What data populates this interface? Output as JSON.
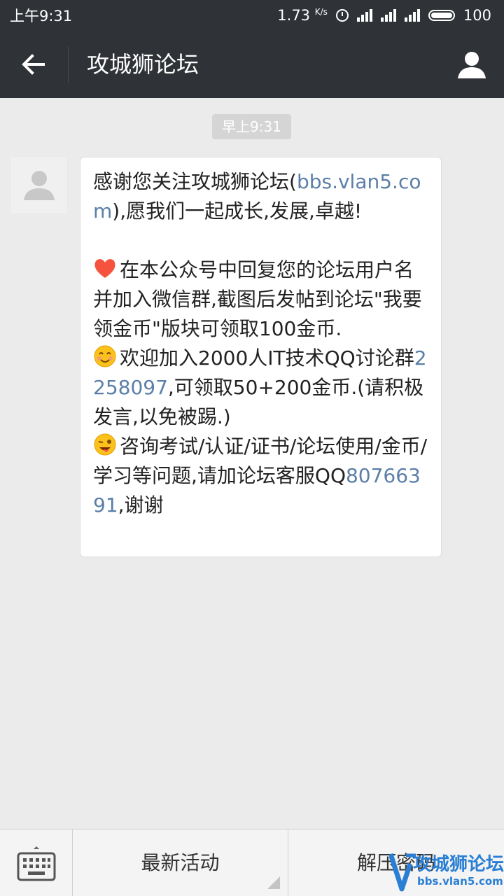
{
  "status_bar": {
    "time": "上午9:31",
    "speed": "1.73",
    "speed_unit": "K/s",
    "battery": "100"
  },
  "header": {
    "title": "攻城狮论坛",
    "back_icon": "arrow-left-icon",
    "profile_icon": "person-icon"
  },
  "chat": {
    "timestamp": "早上9:31",
    "message": {
      "intro_text": "感谢您关注攻城狮论坛(",
      "intro_link": "bbs.vlan5.com",
      "intro_tail": "),愿我们一起成长,发展,卓越!",
      "line1": "在本公众号中回复您的论坛用户名并加入微信群,截图后发帖到论坛\"我要领金币\"版块可领取100金币.",
      "line2_text": "欢迎加入2000人IT技术QQ讨论群",
      "line2_link": "2258097",
      "line2_tail": ",可领取50+200金币.(请积极发言,以免被踢.)",
      "line3_text": "咨询考试/认证/证书/论坛使用/金币/学习等问题,请加论坛客服QQ",
      "line3_link": "80766391",
      "line3_tail": ",谢谢"
    }
  },
  "bottom_menu": {
    "keyboard_icon": "keyboard-icon",
    "item1": "最新活动",
    "item2": "解压密码"
  },
  "watermark": {
    "title": "攻城狮论坛",
    "url": "bbs.vlan5.com"
  },
  "colors": {
    "bar": "#2f3236",
    "background": "#ebebeb",
    "link": "#5b7fa8"
  }
}
